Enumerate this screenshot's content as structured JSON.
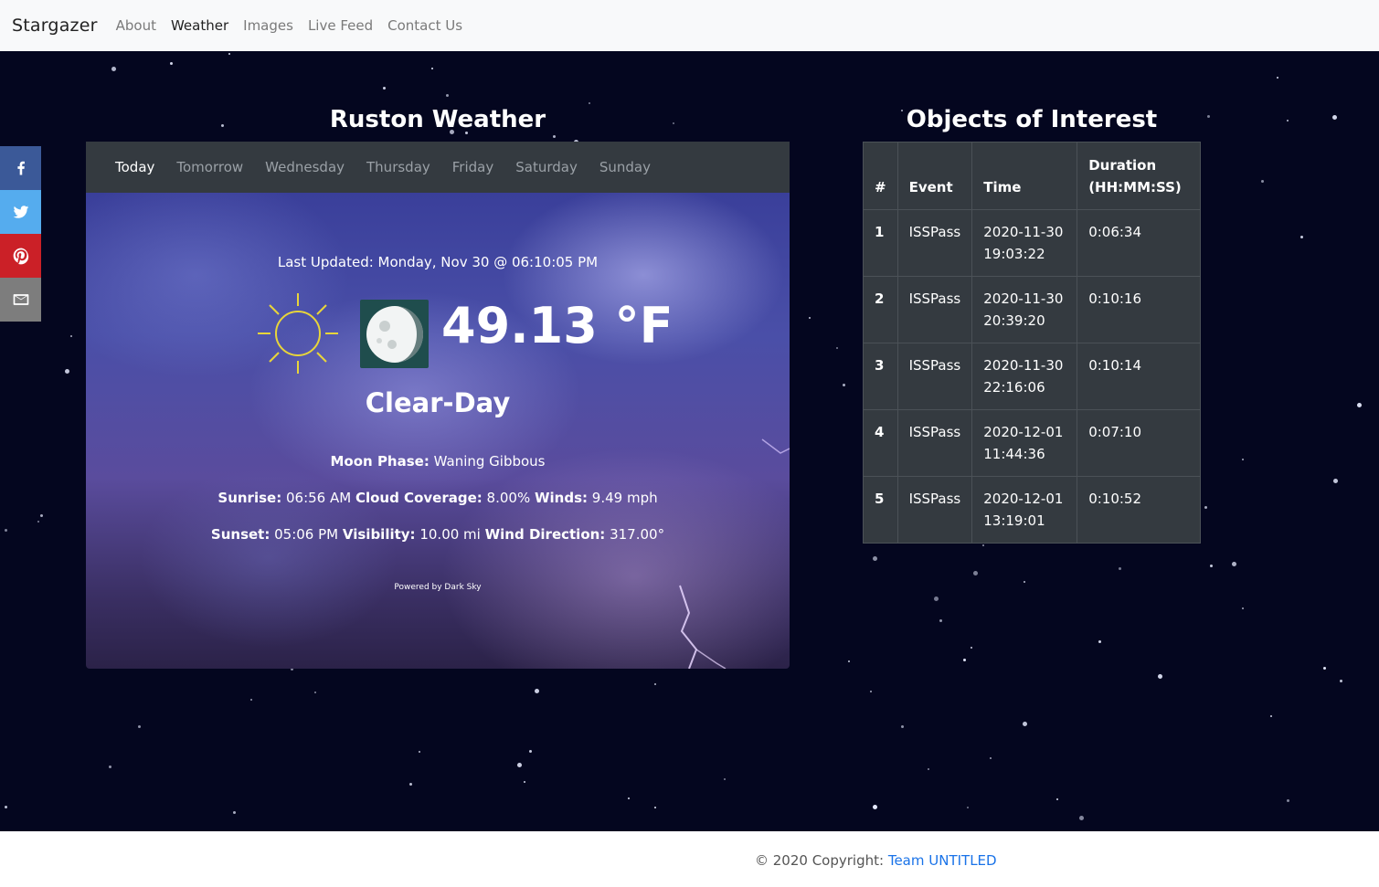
{
  "nav": {
    "brand": "Stargazer",
    "links": [
      "About",
      "Weather",
      "Images",
      "Live Feed",
      "Contact Us"
    ],
    "active": "Weather"
  },
  "social": [
    "facebook-icon",
    "twitter-icon",
    "pinterest-icon",
    "email-icon"
  ],
  "weather": {
    "title": "Ruston Weather",
    "tabs": [
      "Today",
      "Tomorrow",
      "Wednesday",
      "Thursday",
      "Friday",
      "Saturday",
      "Sunday"
    ],
    "active_tab": "Today",
    "last_updated": "Last Updated: Monday, Nov 30 @ 06:10:05 PM",
    "temperature": "49.13 °F",
    "condition": "Clear-Day",
    "moon_phase_label": "Moon Phase:",
    "moon_phase": "Waning Gibbous",
    "sunrise_label": "Sunrise:",
    "sunrise": "06:56 AM",
    "cloud_label": "Cloud Coverage:",
    "cloud": "8.00%",
    "winds_label": "Winds:",
    "winds": "9.49 mph",
    "sunset_label": "Sunset:",
    "sunset": "05:06 PM",
    "visibility_label": "Visibility:",
    "visibility": "10.00 mi",
    "wind_dir_label": "Wind Direction:",
    "wind_dir": "317.00°",
    "powered_by": "Powered by Dark Sky"
  },
  "objects": {
    "title": "Objects of Interest",
    "headers": [
      "#",
      "Event",
      "Time",
      "Duration (HH:MM:SS)"
    ],
    "rows": [
      {
        "num": "1",
        "event": "ISSPass",
        "date": "2020-11-30",
        "time": "19:03:22",
        "duration": "0:06:34"
      },
      {
        "num": "2",
        "event": "ISSPass",
        "date": "2020-11-30",
        "time": "20:39:20",
        "duration": "0:10:16"
      },
      {
        "num": "3",
        "event": "ISSPass",
        "date": "2020-11-30",
        "time": "22:16:06",
        "duration": "0:10:14"
      },
      {
        "num": "4",
        "event": "ISSPass",
        "date": "2020-12-01",
        "time": "11:44:36",
        "duration": "0:07:10"
      },
      {
        "num": "5",
        "event": "ISSPass",
        "date": "2020-12-01",
        "time": "13:19:01",
        "duration": "0:10:52"
      }
    ]
  },
  "footer": {
    "copyright": "© 2020 Copyright: ",
    "team": "Team UNTITLED"
  }
}
